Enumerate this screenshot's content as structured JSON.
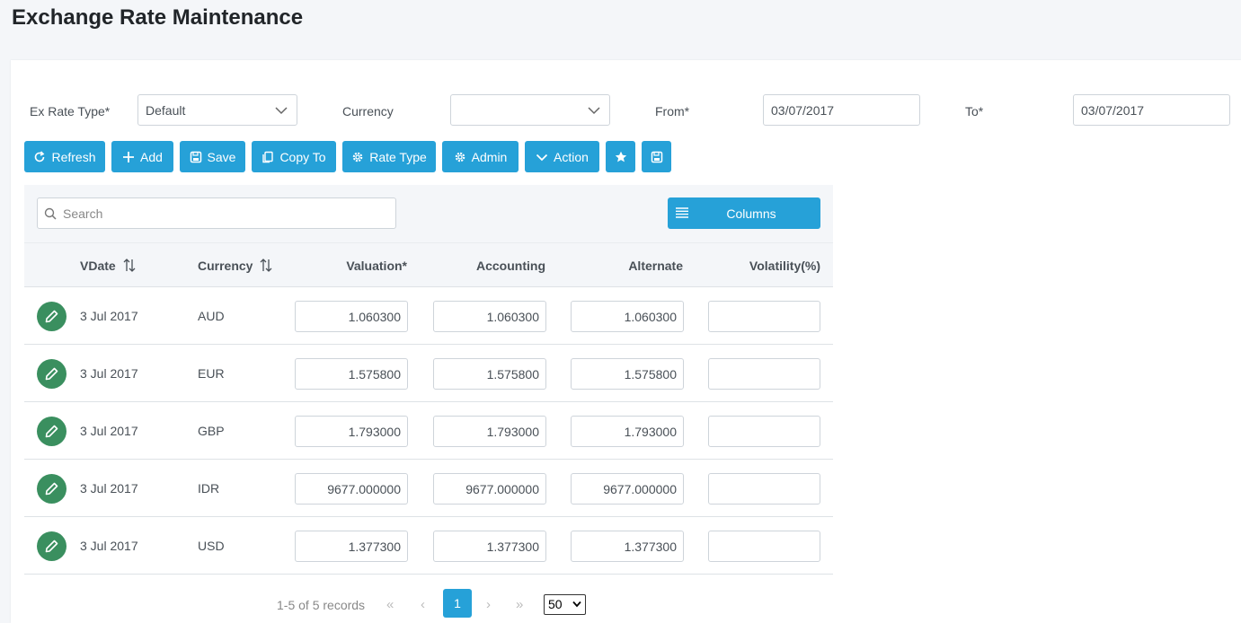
{
  "page": {
    "title": "Exchange Rate Maintenance"
  },
  "filters": {
    "ex_rate_type_label": "Ex Rate Type*",
    "ex_rate_type_value": "Default",
    "currency_label": "Currency",
    "currency_value": "",
    "from_label": "From*",
    "from_value": "03/07/2017",
    "to_label": "To*",
    "to_value": "03/07/2017"
  },
  "toolbar": {
    "refresh": "Refresh",
    "add": "Add",
    "save": "Save",
    "copy_to": "Copy To",
    "rate_type": "Rate Type",
    "admin": "Admin",
    "action": "Action"
  },
  "grid": {
    "search_placeholder": "Search",
    "columns_button": "Columns",
    "headers": {
      "vdate": "VDate",
      "currency": "Currency",
      "valuation": "Valuation*",
      "accounting": "Accounting",
      "alternate": "Alternate",
      "volatility": "Volatility(%)"
    },
    "rows": [
      {
        "vdate": "3 Jul 2017",
        "currency": "AUD",
        "valuation": "1.060300",
        "accounting": "1.060300",
        "alternate": "1.060300",
        "volatility": ""
      },
      {
        "vdate": "3 Jul 2017",
        "currency": "EUR",
        "valuation": "1.575800",
        "accounting": "1.575800",
        "alternate": "1.575800",
        "volatility": ""
      },
      {
        "vdate": "3 Jul 2017",
        "currency": "GBP",
        "valuation": "1.793000",
        "accounting": "1.793000",
        "alternate": "1.793000",
        "volatility": ""
      },
      {
        "vdate": "3 Jul 2017",
        "currency": "IDR",
        "valuation": "9677.000000",
        "accounting": "9677.000000",
        "alternate": "9677.000000",
        "volatility": ""
      },
      {
        "vdate": "3 Jul 2017",
        "currency": "USD",
        "valuation": "1.377300",
        "accounting": "1.377300",
        "alternate": "1.377300",
        "volatility": ""
      }
    ]
  },
  "pager": {
    "info": "1-5 of 5 records",
    "first": "«",
    "prev": "‹",
    "current_page": "1",
    "next": "›",
    "last": "»",
    "page_size": "50"
  },
  "icons": {
    "refresh": "refresh-icon",
    "add": "plus-icon",
    "save": "floppy-icon",
    "copy": "copy-icon",
    "rate_type": "gear-icon",
    "admin": "gear-icon",
    "action": "chevron-down-icon",
    "favorite": "star-icon",
    "save_layout": "floppy-icon",
    "search": "search-icon",
    "columns": "list-icon",
    "edit": "pencil-icon",
    "sort": "sort-icon"
  },
  "colors": {
    "primary": "#26a1d8",
    "edit": "#3a8f5f",
    "background": "#f4f6f9"
  }
}
